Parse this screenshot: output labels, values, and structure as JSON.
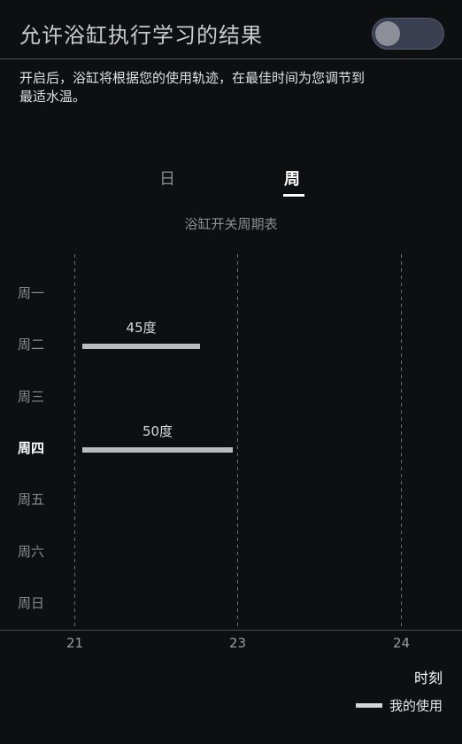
{
  "header": {
    "title": "允许浴缸执行学习的结果",
    "toggle_on": false
  },
  "description": "开启后，浴缸将根据您的使用轨迹，在最佳时间为您调节到最适水温。",
  "tabs": [
    {
      "label": "日",
      "selected": false
    },
    {
      "label": "周",
      "selected": true
    }
  ],
  "colors": {
    "background": "#0e0f11",
    "bar": "#bcbcbe",
    "grid": "#6a6b70"
  },
  "chart_data": {
    "type": "bar",
    "title": "浴缸开关周期表",
    "orientation": "horizontal-range",
    "categories": [
      "周一",
      "周二",
      "周三",
      "周四",
      "周五",
      "周六",
      "周日"
    ],
    "active_category": "周四",
    "x_ticks": [
      "21",
      "23",
      "24"
    ],
    "xlabel": "时刻",
    "series": [
      {
        "name": "我的使用",
        "bars": [
          {
            "category": "周二",
            "start": 21.1,
            "end": 22.5,
            "label": "45度"
          },
          {
            "category": "周四",
            "start": 21.1,
            "end": 22.9,
            "label": "50度"
          }
        ]
      }
    ]
  },
  "legend": {
    "label": "我的使用"
  }
}
